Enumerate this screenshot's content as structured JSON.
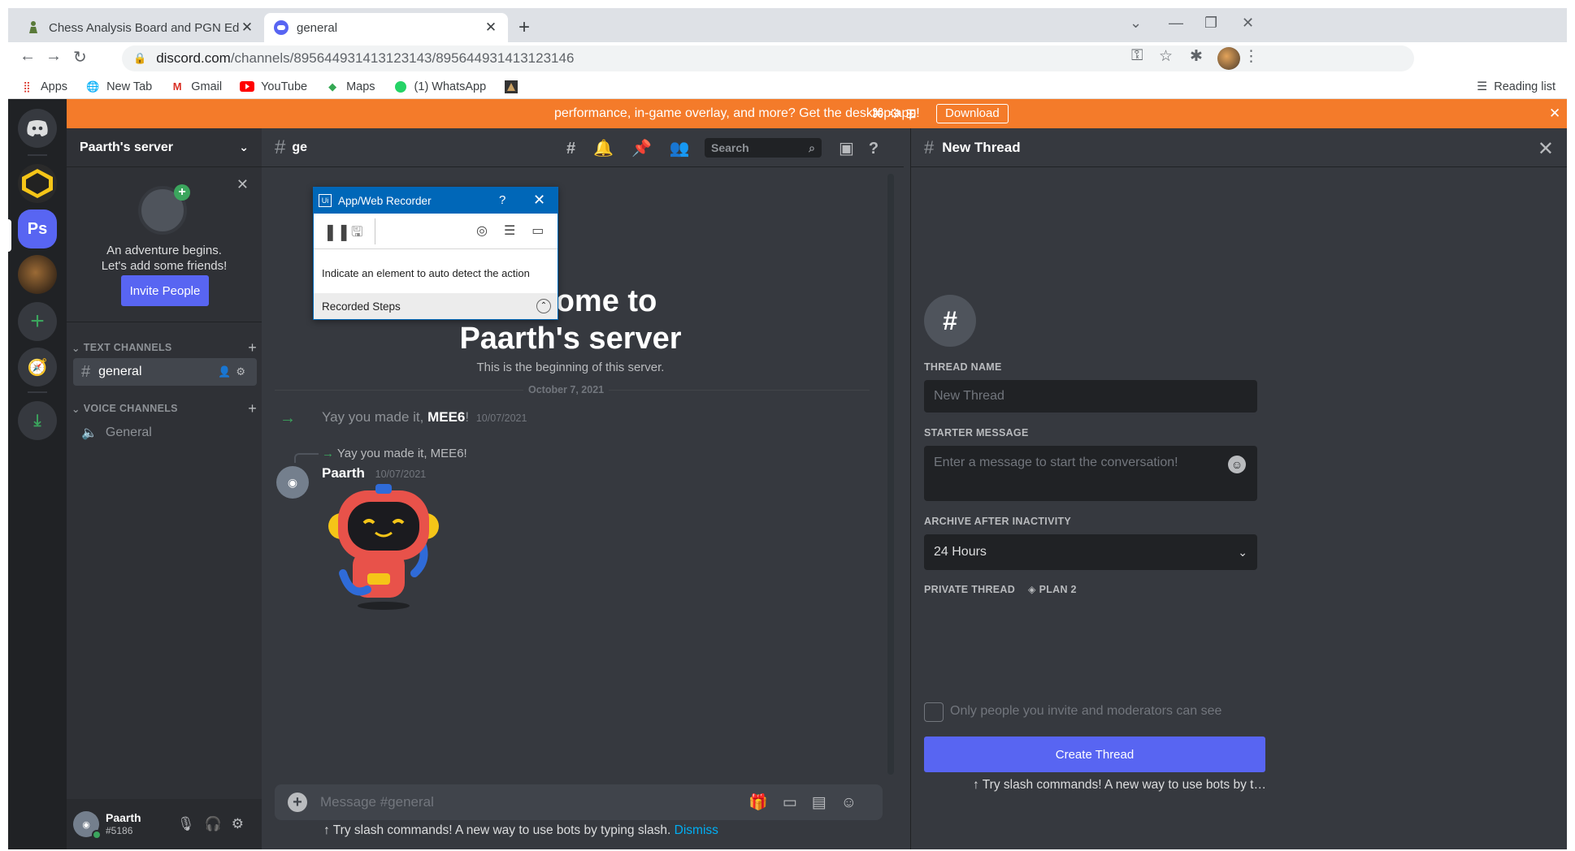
{
  "browser": {
    "tabs": [
      {
        "title": "Chess Analysis Board and PGN Ed",
        "icon": "chess-pawn-icon"
      },
      {
        "title": "general",
        "icon": "discord-icon"
      }
    ],
    "url_host": "discord.com",
    "url_path": "/channels/895644931413123143/895644931413123146",
    "bookmarks": [
      {
        "label": "Apps",
        "icon": "apps-grid-icon"
      },
      {
        "label": "New Tab",
        "icon": "globe-icon"
      },
      {
        "label": "Gmail",
        "icon": "gmail-icon"
      },
      {
        "label": "YouTube",
        "icon": "youtube-icon"
      },
      {
        "label": "Maps",
        "icon": "maps-icon"
      },
      {
        "label": "(1) WhatsApp",
        "icon": "whatsapp-icon"
      }
    ],
    "reading_list": "Reading list"
  },
  "banner": {
    "message": "performance, in-game overlay, and more? Get the desktop app!",
    "download": "Download",
    "color": "#f47b2a"
  },
  "guilds": {
    "active_initials": "Ps"
  },
  "sidebar": {
    "server_name": "Paarth's server",
    "friends_line1": "An adventure begins.",
    "friends_line2": "Let's add some friends!",
    "invite_label": "Invite People",
    "text_category": "TEXT CHANNELS",
    "text_channel": "general",
    "voice_category": "VOICE CHANNELS",
    "voice_channel": "General",
    "user_name": "Paarth",
    "user_tag": "#5186"
  },
  "chat": {
    "channel": "ge",
    "search_placeholder": "Search",
    "welcome_line1": "Welcome to",
    "welcome_line2": "Paarth's server",
    "beginning": "This is the beginning of this server.",
    "date_divider": "October 7, 2021",
    "join_prefix": "Yay you made it, ",
    "join_name": "MEE6",
    "join_suffix": "!",
    "join_time": "10/07/2021",
    "reply_text": "Yay you made it, MEE6!",
    "author": "Paarth",
    "author_time": "10/07/2021",
    "composer_placeholder": "Message #general",
    "slash_tip": "Try slash commands! A new way to use bots by typing slash.",
    "dismiss": "Dismiss"
  },
  "thread": {
    "title": "New Thread",
    "name_label": "THREAD NAME",
    "name_placeholder": "New Thread",
    "starter_label": "STARTER MESSAGE",
    "starter_placeholder": "Enter a message to start the conversation!",
    "archive_label": "ARCHIVE AFTER INACTIVITY",
    "archive_value": "24 Hours",
    "private_label": "PRIVATE THREAD",
    "plan_badge": "PLAN 2",
    "private_desc": "Only people you invite and moderators can see",
    "create_label": "Create Thread",
    "slash_tip": "Try slash commands! A new way to use bots by typing s..."
  },
  "recorder": {
    "title": "App/Web Recorder",
    "hint": "Indicate an element to auto detect the action",
    "steps_label": "Recorded Steps"
  },
  "colors": {
    "blurple": "#5865f2",
    "green": "#3ba55d",
    "recorder_blue": "#0067b8"
  }
}
